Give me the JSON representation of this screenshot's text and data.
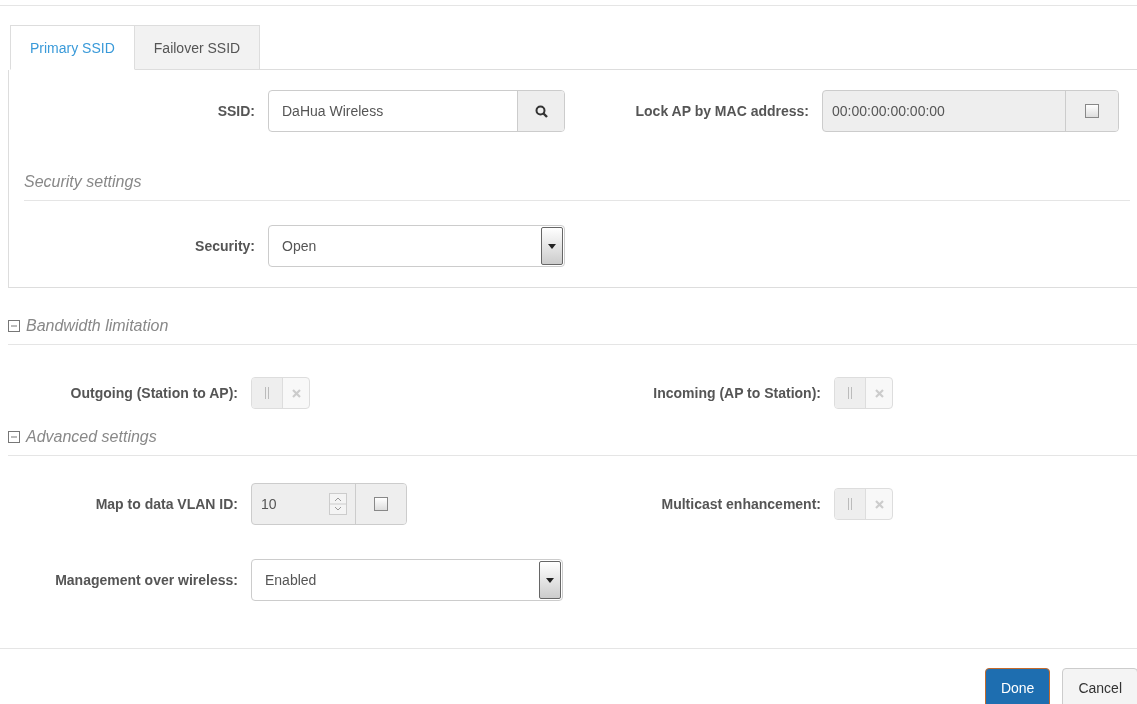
{
  "tabs": [
    {
      "label": "Primary SSID",
      "selected": true
    },
    {
      "label": "Failover SSID",
      "selected": false
    }
  ],
  "ssid": {
    "label": "SSID:",
    "value": "DaHua Wireless"
  },
  "lock_ap": {
    "label": "Lock AP by MAC address:",
    "value": "00:00:00:00:00:00",
    "checked": false
  },
  "security_section": {
    "title": "Security settings"
  },
  "security": {
    "label": "Security:",
    "value": "Open"
  },
  "sections": [
    {
      "title": "Bandwidth limitation",
      "expanded": true,
      "fields": [
        {
          "kind": "toggle",
          "label": "Outgoing (Station to AP):",
          "on": false
        },
        {
          "kind": "toggle",
          "label": "Incoming (AP to Station):",
          "on": false
        }
      ]
    },
    {
      "title": "Advanced settings",
      "expanded": true,
      "fields": [
        {
          "kind": "vlan",
          "label": "Map to data VLAN ID:",
          "value": "10",
          "checked": false
        },
        {
          "kind": "toggle",
          "label": "Multicast enhancement:",
          "on": false
        },
        {
          "kind": "select",
          "label": "Management over wireless:",
          "value": "Enabled"
        }
      ]
    }
  ],
  "buttons": [
    {
      "label": "Done",
      "kind": "primary"
    },
    {
      "label": "Cancel",
      "kind": "default"
    }
  ]
}
